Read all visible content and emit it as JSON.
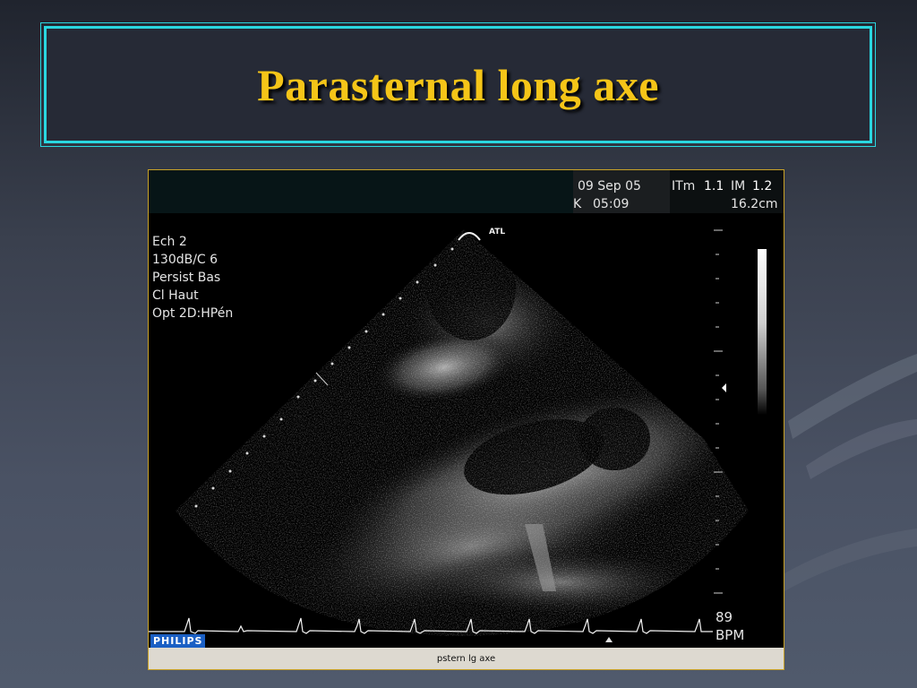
{
  "slide": {
    "title": "Parasternal long axe"
  },
  "ultrasound": {
    "date": "09 Sep 05",
    "time_prefix": "K",
    "time": "05:09",
    "itm_label": "ITm",
    "itm_value": "1.1",
    "im_label": "IM",
    "im_value": "1.2",
    "depth": "16.2cm",
    "probe_label": "ATL",
    "settings": [
      "Ech 2",
      "130dB/C 6",
      "Persist Bas",
      "Cl Haut",
      "Opt 2D:HPén"
    ],
    "heart_rate": "89",
    "heart_rate_unit": "BPM",
    "brand": "PHILIPS",
    "caption": "pstern lg axe"
  },
  "colors": {
    "title": "#f5c518",
    "title_border": "#2ad7e0",
    "frame_border": "#c9a227"
  }
}
